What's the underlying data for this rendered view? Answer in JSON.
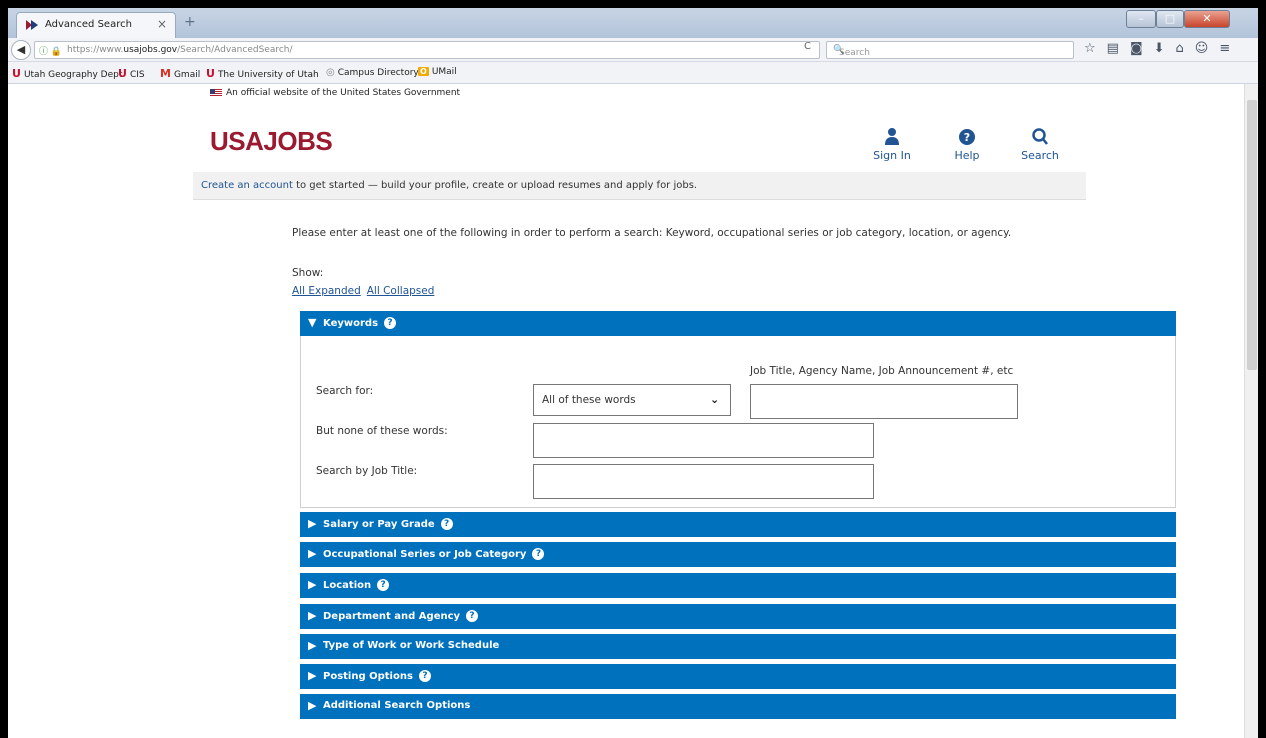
{
  "browser": {
    "tab_title": "Advanced Search",
    "tab_close": "×",
    "new_tab": "+",
    "url_prefix": "https://www.",
    "url_host": "usajobs.gov",
    "url_path": "/Search/AdvancedSearch/",
    "search_placeholder": "Search",
    "bookmarks": [
      {
        "icon": "U",
        "label": "Utah Geography Dept"
      },
      {
        "icon": "U",
        "label": "CIS"
      },
      {
        "icon": "M",
        "label": "Gmail"
      },
      {
        "icon": "U",
        "label": "The University of Utah"
      },
      {
        "icon": "◎",
        "label": "Campus Directory"
      },
      {
        "icon": "O",
        "label": "UMail"
      }
    ]
  },
  "page": {
    "gov_banner": "An official website of the United States Government",
    "logo": "USAJOBS",
    "header_nav": {
      "sign_in": "Sign In",
      "help": "Help",
      "search": "Search"
    },
    "account_bar": {
      "link": "Create an account",
      "text": " to get started — build your profile, create or upload resumes and apply for jobs."
    },
    "instructions": "Please enter at least one of the following in order to perform a search: Keyword, occupational series or job category, location, or agency.",
    "show_label": "Show:",
    "show_all_expanded": "All Expanded",
    "show_all_collapsed": "All Collapsed",
    "keywords_section": {
      "title": "Keywords",
      "hint": "Job Title, Agency Name, Job Announcement #, etc",
      "search_for_label": "Search for:",
      "match_mode_selected": "All of these words",
      "none_of_label": "But none of these words:",
      "job_title_label": "Search by Job Title:"
    },
    "sections": [
      {
        "title": "Salary or Pay Grade",
        "has_help": true
      },
      {
        "title": "Occupational Series or Job Category",
        "has_help": true
      },
      {
        "title": "Location",
        "has_help": true
      },
      {
        "title": "Department and Agency",
        "has_help": true
      },
      {
        "title": "Type of Work or Work Schedule",
        "has_help": false
      },
      {
        "title": "Posting Options",
        "has_help": true
      },
      {
        "title": "Additional Search Options",
        "has_help": false
      }
    ]
  },
  "colors": {
    "brand": "#9b1a2f",
    "section_blue": "#0071bc",
    "link_blue": "#205493"
  }
}
